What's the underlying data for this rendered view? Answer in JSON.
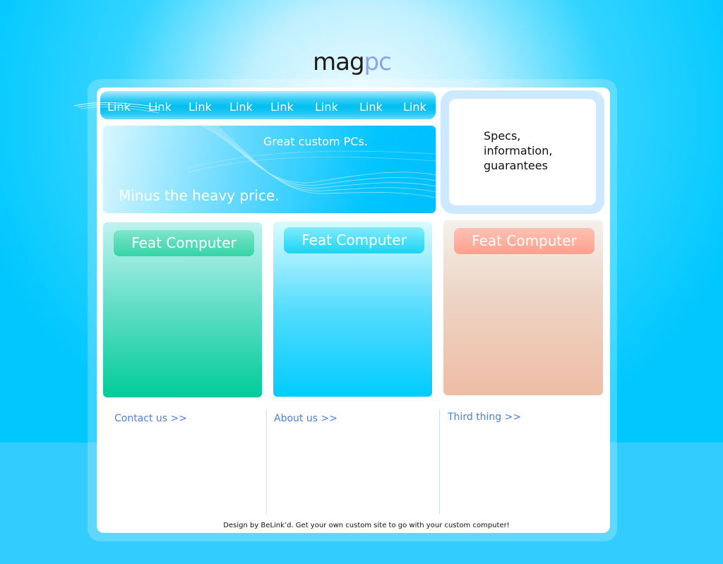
{
  "logo": {
    "part1": "mag",
    "part2": "pc"
  },
  "nav": {
    "links": [
      "Link",
      "Link",
      "Link",
      "Link",
      "Link",
      "Link",
      "Link",
      "Link"
    ]
  },
  "hero": {
    "tagline": "Great custom PCs.",
    "subtitle": "Minus the heavy price."
  },
  "info_box": {
    "text": "Specs, information, guarantees"
  },
  "features": [
    {
      "label": "Feat Computer"
    },
    {
      "label": "Feat Computer"
    },
    {
      "label": "Feat Computer"
    }
  ],
  "footer": {
    "links": [
      "Contact us >>",
      "About us >>",
      "Third thing >>"
    ],
    "credit": "Design by BeLink’d. Get your own custom site to go with your custom computer!"
  },
  "colors": {
    "accent": "#00c8ff",
    "link": "#4a7fe0",
    "card_green": "#00cc99",
    "card_blue": "#00ccff",
    "card_peach": "#eebda4"
  }
}
